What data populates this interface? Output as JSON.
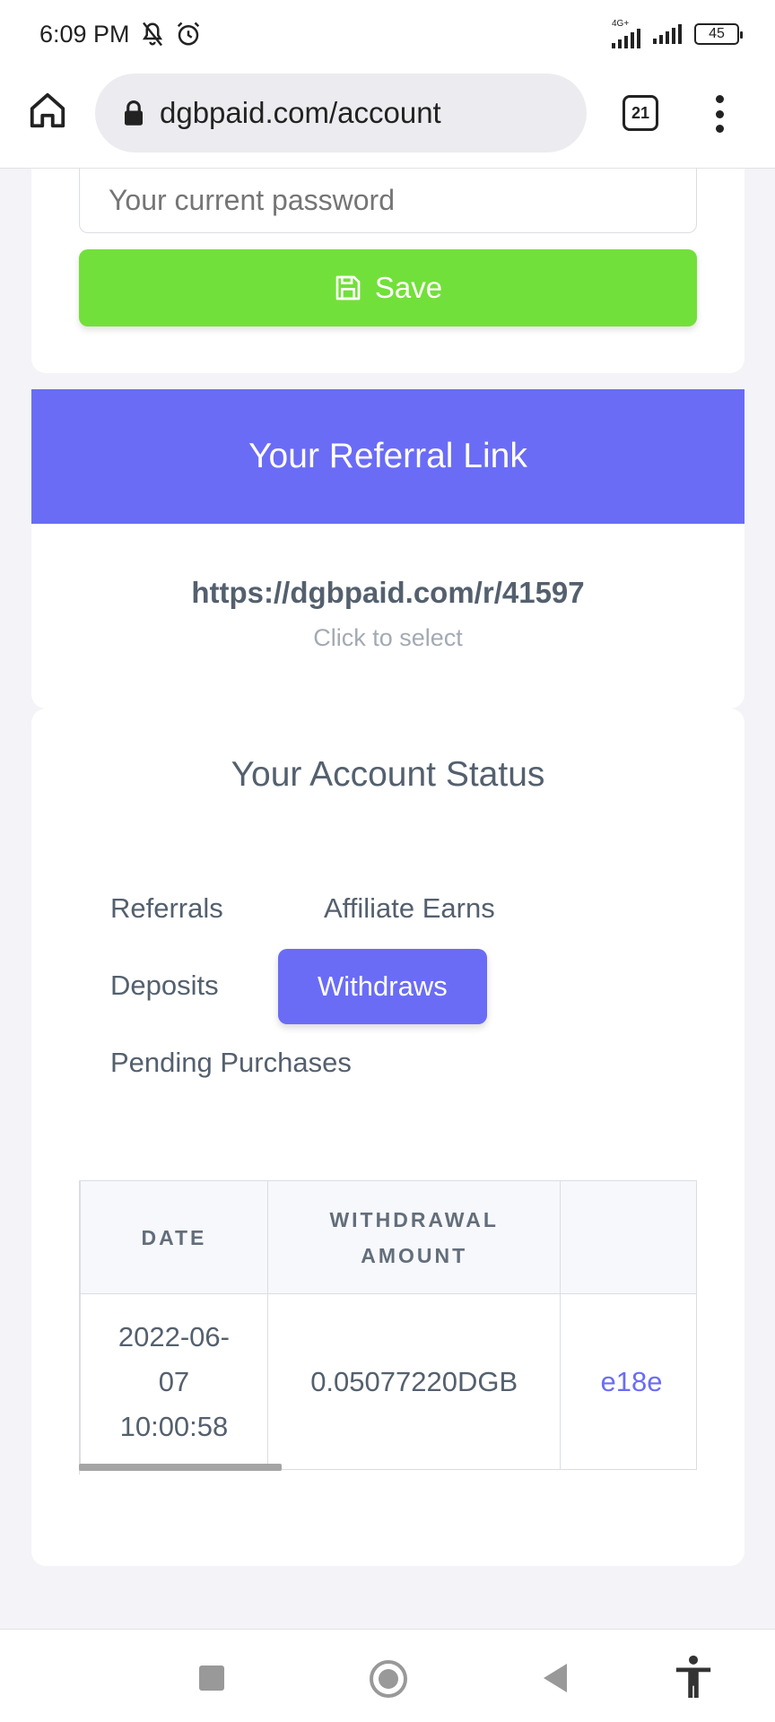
{
  "status_bar": {
    "time": "6:09 PM",
    "network": "4G+",
    "battery": "45"
  },
  "browser": {
    "url": "dgbpaid.com/account",
    "tab_count": "21"
  },
  "password_form": {
    "current_password_placeholder": "Your current password",
    "save_label": "Save"
  },
  "referral": {
    "title": "Your Referral Link",
    "link": "https://dgbpaid.com/r/41597",
    "hint": "Click to select"
  },
  "account_status": {
    "title": "Your Account Status",
    "tabs": [
      {
        "label": "Referrals",
        "active": false
      },
      {
        "label": "Affiliate Earns",
        "active": false
      },
      {
        "label": "Deposits",
        "active": false
      },
      {
        "label": "Withdraws",
        "active": true
      },
      {
        "label": "Pending Purchases",
        "active": false
      }
    ],
    "table": {
      "headers": [
        "DATE",
        "WITHDRAWAL AMOUNT",
        ""
      ],
      "rows": [
        {
          "date": "2022-06-07 10:00:58",
          "amount": "0.05077220DGB",
          "hash": "e18e"
        }
      ]
    }
  },
  "colors": {
    "accent": "#6a6cf6",
    "save": "#72e03a"
  }
}
